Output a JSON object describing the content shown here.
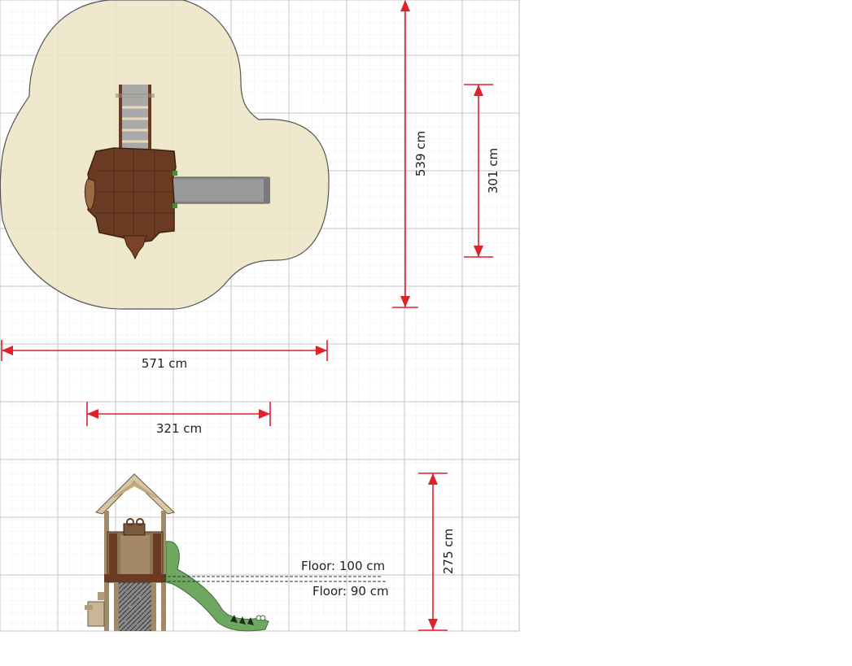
{
  "colors": {
    "grid_minor": "#ebebeb",
    "grid_major": "#c9c9c9",
    "safety_zone_fill": "#ece4c4",
    "safety_zone_stroke": "#5a5a5a",
    "dimension": "#e0202a",
    "wood_dark": "#6b3a22",
    "wood_light": "#9a7c5c",
    "roof": "#d8c7a6",
    "slide_green": "#6ea860",
    "slide_metal": "#8c8c8c",
    "text": "#222222"
  },
  "dimensions": {
    "total_width": "571 cm",
    "structure_width": "321 cm",
    "total_depth": "539 cm",
    "structure_depth": "301 cm",
    "height": "275 cm"
  },
  "floor_labels": {
    "upper": "Floor: 100 cm",
    "lower": "Floor: 90 cm"
  },
  "icons": {
    "slide": "slide-icon",
    "ladder": "ladder-icon",
    "tower": "tower-icon"
  }
}
